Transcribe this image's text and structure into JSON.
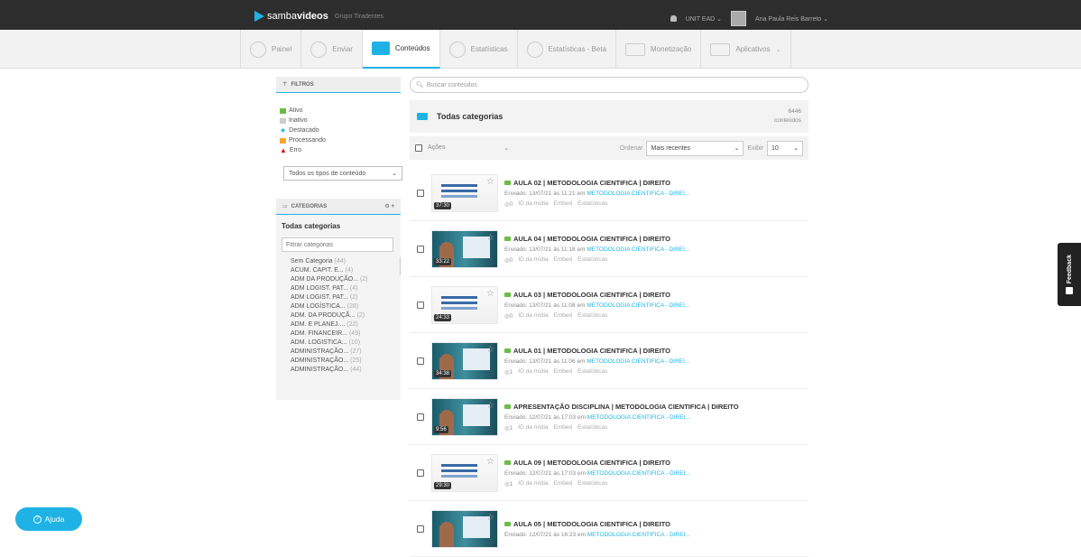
{
  "topbar": {
    "brand_light": "samba",
    "brand_bold": "videos",
    "group": "Grupo Tiradentes",
    "account": "UNIT EAD",
    "user": "Ana Paula Reis Barreto"
  },
  "nav": [
    {
      "label": "Painel",
      "active": false
    },
    {
      "label": "Enviar",
      "active": false
    },
    {
      "label": "Conteúdos",
      "active": true
    },
    {
      "label": "Estatísticas",
      "active": false
    },
    {
      "label": "Estatísticas - Beta",
      "active": false
    },
    {
      "label": "Monetização",
      "active": false
    },
    {
      "label": "Aplicativos",
      "active": false
    }
  ],
  "filters": {
    "title": "FILTROS",
    "items": [
      {
        "label": "Ativo",
        "color": "#6cbd45"
      },
      {
        "label": "Inativo",
        "color": "#cccccc"
      },
      {
        "label": "Destacado",
        "color": "#1fb3e5"
      },
      {
        "label": "Processando",
        "color": "#f0a92e"
      },
      {
        "label": "Erro",
        "color": "#dd1111"
      }
    ],
    "content_type": "Todos os tipos de conteúdo"
  },
  "categories": {
    "title": "CATEGORIAS",
    "all_label": "Todas categorias",
    "filter_placeholder": "Filtrar categorias",
    "items": [
      {
        "name": "Sem Categoria",
        "count": "(44)"
      },
      {
        "name": "ACUM. CAPIT. E...",
        "count": "(4)"
      },
      {
        "name": "ADM DA PRODUÇÃO...",
        "count": "(2)"
      },
      {
        "name": "ADM LOGIST. PAT...",
        "count": "(4)"
      },
      {
        "name": "ADM LOGIST. PAT...",
        "count": "(2)"
      },
      {
        "name": "ADM LOGÍSTICA...",
        "count": "(28)"
      },
      {
        "name": "ADM. DA PRODUÇÃ...",
        "count": "(2)"
      },
      {
        "name": "ADM. E PLANEJ....",
        "count": "(22)"
      },
      {
        "name": "ADM. FINANCEIR...",
        "count": "(49)"
      },
      {
        "name": "ADM. LOGISTICA...",
        "count": "(10)"
      },
      {
        "name": "ADMINISTRAÇÃO...",
        "count": "(27)"
      },
      {
        "name": "ADMINISTRAÇÃO...",
        "count": "(25)"
      },
      {
        "name": "ADMINISTRAÇÃO...",
        "count": "(44)"
      }
    ]
  },
  "main": {
    "search_placeholder": "Buscar conteúdos",
    "category_title": "Todas categorias",
    "count_value": "6446",
    "count_label": "conteúdos",
    "actions_label": "Ações",
    "sort_label": "Ordenar",
    "sort_value": "Mais recentes",
    "show_label": "Exibir",
    "show_value": "10",
    "row_actions": {
      "id": "ID da mídia",
      "embed": "Embed",
      "stats": "Estatísticas"
    },
    "videos": [
      {
        "title": "AULA 02 | METODOLOGIA CIENTIFICA | DIREITO",
        "sent": "Enviado: 13/07/21 às 11:21 em",
        "category": "METODOLOGIA CIENTIFICA - DIREI...",
        "views": "0",
        "duration": "37:30",
        "thumb": "slide"
      },
      {
        "title": "AULA 04 | METODOLOGIA CIENTIFICA | DIREITO",
        "sent": "Enviado: 13/07/21 às 11:18 em",
        "category": "METODOLOGIA CIENTIFICA - DIREI...",
        "views": "0",
        "duration": "33:22",
        "thumb": "video"
      },
      {
        "title": "AULA 03 | METODOLOGIA CIENTIFICA | DIREITO",
        "sent": "Enviado: 13/07/21 às 11:08 em",
        "category": "METODOLOGIA CIENTIFICA - DIREI...",
        "views": "0",
        "duration": "24:33",
        "thumb": "slide"
      },
      {
        "title": "AULA 01 | METODOLOGIA CIENTIFICA | DIREITO",
        "sent": "Enviado: 13/07/21 às 11:06 em",
        "category": "METODOLOGIA CIENTIFICA - DIREI...",
        "views": "1",
        "duration": "34:38",
        "thumb": "video"
      },
      {
        "title": "APRESENTAÇÃO DISCIPLINA | METODOLOGIA CIENTIFICA | DIREITO",
        "sent": "Enviado: 12/07/21 às 17:03 em",
        "category": "METODOLOGIA CIENTIFICA - DIREI...",
        "views": "1",
        "duration": "9:56",
        "thumb": "video"
      },
      {
        "title": "AULA 09 | METODOLOGIA CIENTIFICA | DIREITO",
        "sent": "Enviado: 12/07/21 às 17:03 em",
        "category": "METODOLOGIA CIENTIFICA - DIREI...",
        "views": "1",
        "duration": "29:30",
        "thumb": "slide"
      },
      {
        "title": "AULA 05 | METODOLOGIA CIENTIFICA | DIREITO",
        "sent": "Enviado: 12/07/21 às 16:23 em",
        "category": "METODOLOGIA CIENTIFICA - DIREI...",
        "views": "",
        "duration": "",
        "thumb": "video"
      }
    ]
  },
  "feedback_label": "Feedback",
  "help_label": "Ajuda",
  "icons": {
    "bell": "bell-icon",
    "search": "search-icon",
    "folder": "folder-icon",
    "star": "star-icon",
    "eye": "eye-icon",
    "gear": "gear-icon",
    "plus": "plus-icon"
  }
}
